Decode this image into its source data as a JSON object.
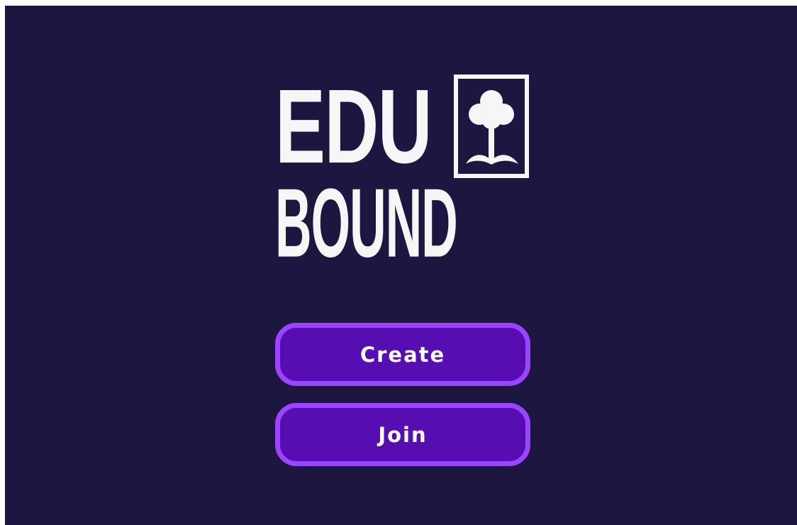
{
  "logo": {
    "line1": "EDU",
    "line2": "BOUND",
    "emblem_icon": "tree-sprout-icon"
  },
  "buttons": {
    "create_label": "Create",
    "join_label": "Join"
  },
  "colors": {
    "background": "#1c1640",
    "logo_text": "#f6f6f7",
    "button_fill": "#560db2",
    "button_border": "#9a45ff"
  }
}
